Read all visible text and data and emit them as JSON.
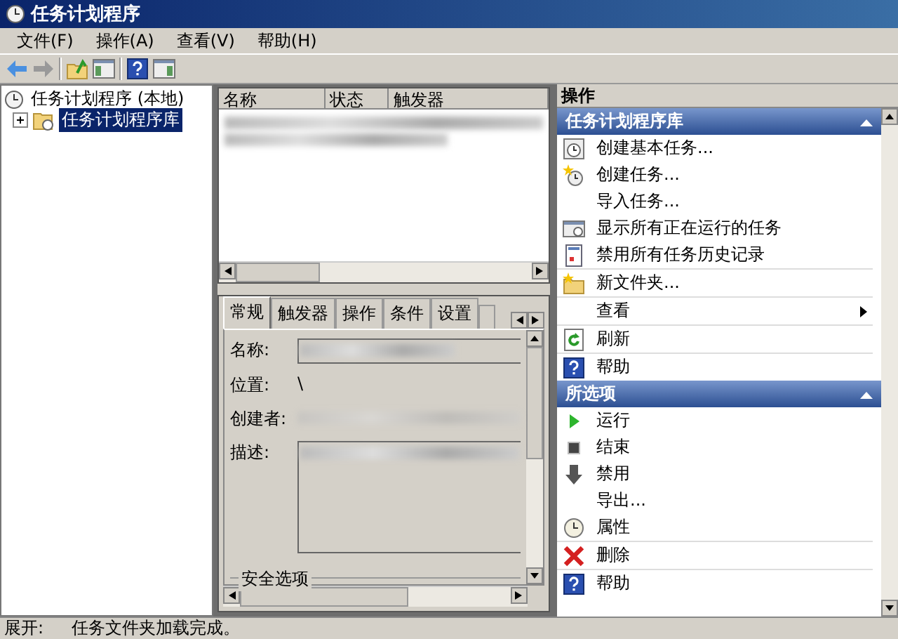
{
  "window": {
    "title": "任务计划程序"
  },
  "menu": [
    "文件(F)",
    "操作(A)",
    "查看(V)",
    "帮助(H)"
  ],
  "tree": [
    {
      "label": "任务计划程序 (本地)",
      "selected": false,
      "children": [
        {
          "label": "任务计划程序库",
          "selected": true,
          "expanded": false
        }
      ]
    }
  ],
  "task_list": {
    "columns": [
      "名称",
      "状态",
      "触发器"
    ]
  },
  "detail": {
    "tabs": [
      {
        "label": "常规",
        "selected": true
      },
      {
        "label": "触发器",
        "selected": false
      },
      {
        "label": "操作",
        "selected": false
      },
      {
        "label": "条件",
        "selected": false
      },
      {
        "label": "设置",
        "selected": false
      }
    ],
    "fields": [
      {
        "label": "名称:",
        "kind": "input"
      },
      {
        "label": "位置:",
        "kind": "text",
        "value": "\\"
      },
      {
        "label": "创建者:",
        "kind": "blurred"
      },
      {
        "label": "描述:",
        "kind": "textarea"
      }
    ],
    "group_title": "安全选项"
  },
  "actions_pane": {
    "title": "操作",
    "sections": [
      {
        "title": "任务计划程序库",
        "expanded": true,
        "items": [
          {
            "label": "创建基本任务...",
            "kind": "clock-page",
            "divider_before": false
          },
          {
            "label": "创建任务...",
            "kind": "star-clock",
            "divider_before": false
          },
          {
            "label": "导入任务...",
            "kind": "plain",
            "divider_before": false
          },
          {
            "label": "显示所有正在运行的任务",
            "kind": "window-clock",
            "divider_before": false
          },
          {
            "label": "禁用所有任务历史记录",
            "kind": "log",
            "divider_before": false
          },
          {
            "label": "新文件夹...",
            "kind": "folder-star",
            "divider_before": true
          },
          {
            "label": "查看",
            "kind": "plain",
            "divider_before": true,
            "submenu": true
          },
          {
            "label": "刷新",
            "kind": "refresh",
            "divider_before": true
          },
          {
            "label": "帮助",
            "kind": "help",
            "divider_before": true
          }
        ]
      },
      {
        "title": "所选项",
        "expanded": true,
        "items": [
          {
            "label": "运行",
            "kind": "play",
            "divider_before": false
          },
          {
            "label": "结束",
            "kind": "stop",
            "divider_before": false
          },
          {
            "label": "禁用",
            "kind": "down-arrow",
            "divider_before": false
          },
          {
            "label": "导出...",
            "kind": "plain",
            "divider_before": false
          },
          {
            "label": "属性",
            "kind": "clock",
            "divider_before": false
          },
          {
            "label": "删除",
            "kind": "delete",
            "divider_before": true
          },
          {
            "label": "帮助",
            "kind": "help",
            "divider_before": true
          }
        ]
      }
    ]
  },
  "status_bar": {
    "label": "展开:",
    "message": "任务文件夹加载完成。"
  }
}
